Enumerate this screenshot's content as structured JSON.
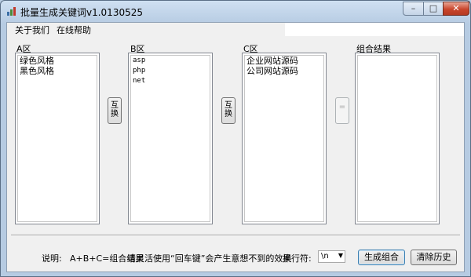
{
  "window": {
    "title": "批量生成关键词v1.0130525",
    "controls": {
      "minimize": "–",
      "maximize": "□",
      "close": "✕"
    }
  },
  "menu": {
    "items": [
      "关于我们",
      "在线帮助"
    ]
  },
  "groups": {
    "a": {
      "label": "A区",
      "items": [
        "绿色风格",
        "黑色风格"
      ]
    },
    "b": {
      "label": "B区",
      "items": [
        "asp",
        "php",
        "net"
      ]
    },
    "c": {
      "label": "C区",
      "items": [
        "企业网站源码",
        "公司网站源码"
      ]
    },
    "result": {
      "label": "组合结果",
      "items": []
    }
  },
  "buttons": {
    "swap_ab": "互换",
    "swap_bc": "互换",
    "equals": "="
  },
  "footer": {
    "desc_label": "说明:",
    "desc_formula": "A+B+C=组合结果",
    "desc_hint": "请灵活使用“回车键”会产生意想不到的效果",
    "separator_label": "换行符:",
    "separator_value": "\\n",
    "generate_label": "生成组合",
    "clear_label": "清除历史"
  },
  "colors": {
    "title_bar": "#b6cbe2",
    "close_button": "#c9462c",
    "client_bg": "#f0f0f0"
  }
}
